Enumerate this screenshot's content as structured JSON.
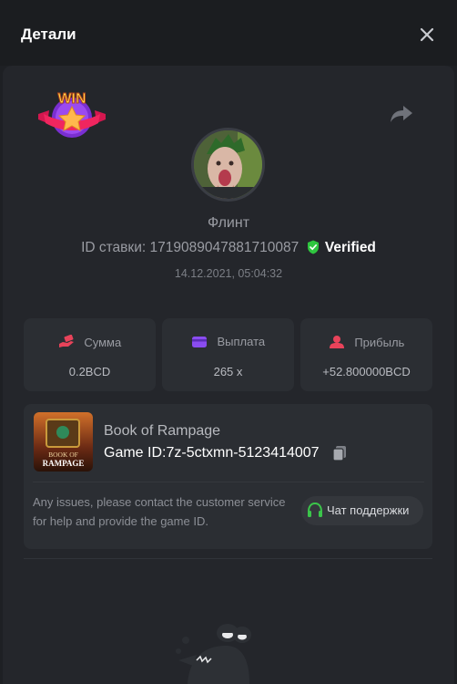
{
  "header": {
    "title": "Детали",
    "close_icon": "close-icon"
  },
  "user": {
    "name": "Флинт"
  },
  "bet": {
    "id_label": "ID ставки:",
    "id_value": "1719089047881710087",
    "verified_label": "Verified",
    "date": "14.12.2021, 05:04:32"
  },
  "stats": [
    {
      "icon": "money-hand-icon",
      "label": "Сумма",
      "value": "0.2BCD"
    },
    {
      "icon": "wallet-icon",
      "label": "Выплата",
      "value": "265 x"
    },
    {
      "icon": "profit-icon",
      "label": "Прибыль",
      "value": "+52.800000BCD"
    }
  ],
  "game": {
    "name": "Book of Rampage",
    "id_label": "Game ID:",
    "id_value": "7z-5ctxmn-5123414007",
    "thumb_lines": [
      "BOOK OF",
      "RAMPAGE"
    ],
    "help_text": "Any issues, please contact the customer service for help and provide the game ID.",
    "support_label": "Чат поддержки"
  },
  "badge": {
    "text": "WIN"
  },
  "colors": {
    "verified": "#2fc53f",
    "accent_green": "#3bc54a",
    "stat_icon_red": "#e8435a",
    "stat_icon_purple": "#8a4cf0"
  }
}
